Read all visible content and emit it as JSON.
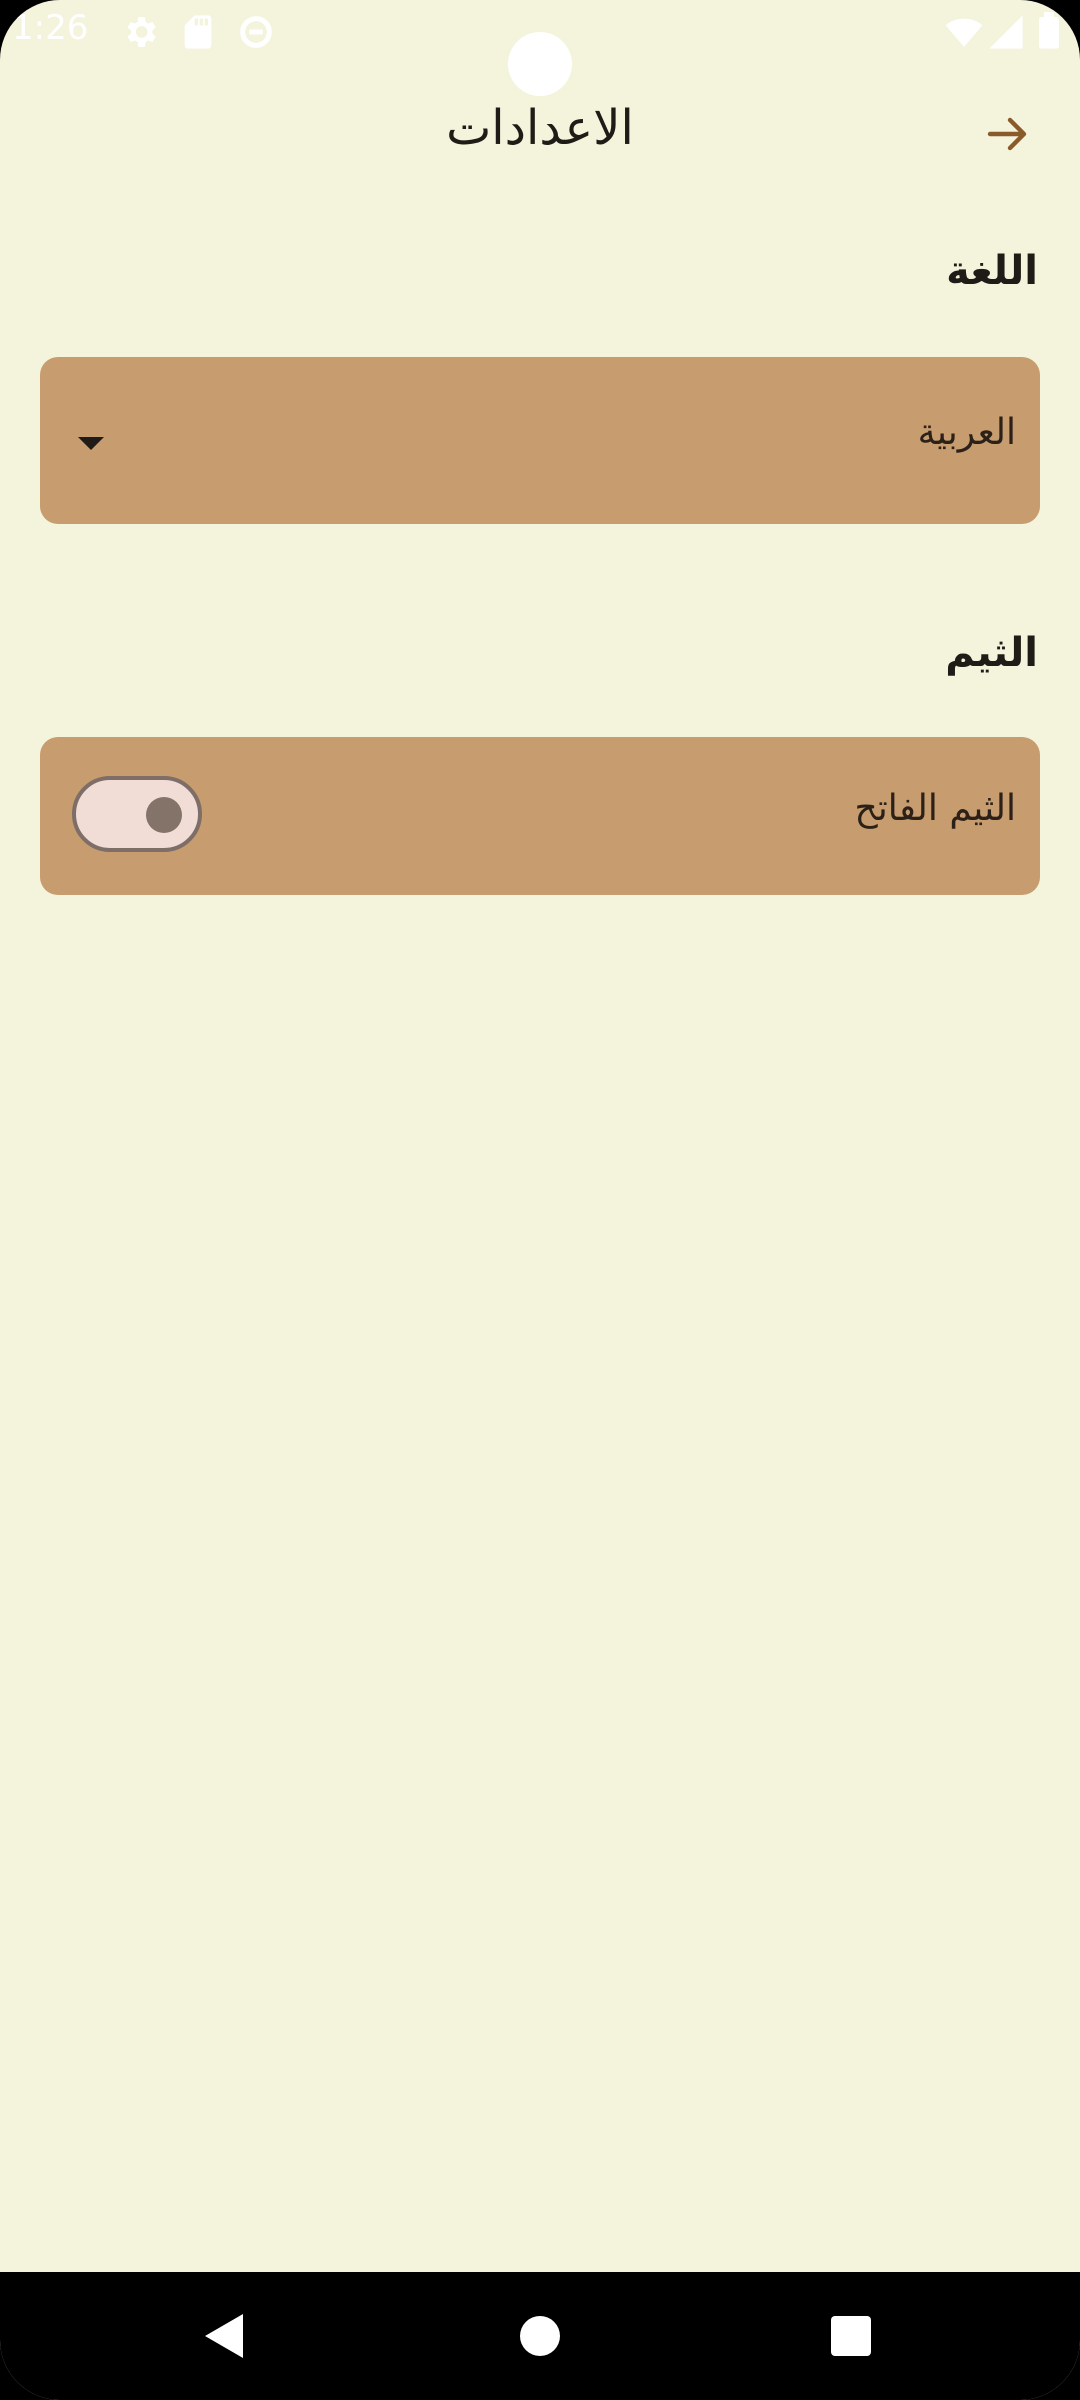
{
  "status_bar": {
    "time": "1:26",
    "icons": [
      "gear-icon",
      "sd-card-icon",
      "data-saver-icon",
      "wifi-icon",
      "signal-icon",
      "battery-icon"
    ]
  },
  "app_bar": {
    "title": "الاعدادات",
    "back_icon": "arrow-forward-icon"
  },
  "language_section": {
    "title": "اللغة",
    "selected_value": "العربية",
    "dropdown_icon": "dropdown-arrow-icon"
  },
  "theme_section": {
    "title": "الثيم",
    "toggle_label": "الثيم الفاتح",
    "toggle_on": false
  },
  "nav_bar": {
    "icons": [
      "nav-back-icon",
      "nav-home-icon",
      "nav-recents-icon"
    ]
  },
  "colors": {
    "background": "#f4f3dc",
    "card": "#c79c6e",
    "accent": "#8b5a2b",
    "text": "#1f1b16"
  }
}
